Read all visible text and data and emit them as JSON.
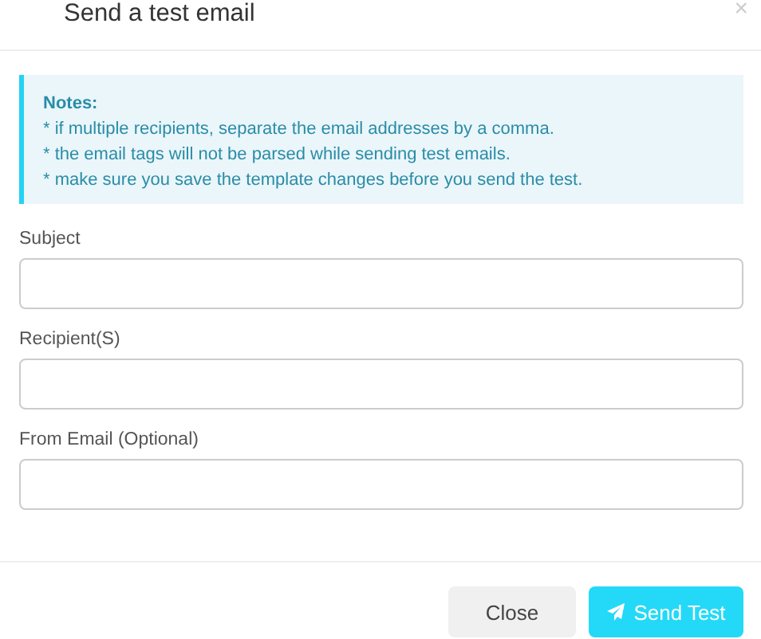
{
  "dialog": {
    "title": "Send a test email",
    "close_icon": "×"
  },
  "notes": {
    "heading": "Notes:",
    "lines": [
      "* if multiple recipients, separate the email addresses by a comma.",
      "* the email tags will not be parsed while sending test emails.",
      "* make sure you save the template changes before you send the test."
    ]
  },
  "fields": [
    {
      "label": "Subject"
    },
    {
      "label": "Recipient(S)"
    },
    {
      "label": "From Email (Optional)"
    }
  ],
  "buttons": [
    {
      "label": "Close",
      "kind": "secondary"
    },
    {
      "label": "Send Test",
      "kind": "primary"
    }
  ]
}
